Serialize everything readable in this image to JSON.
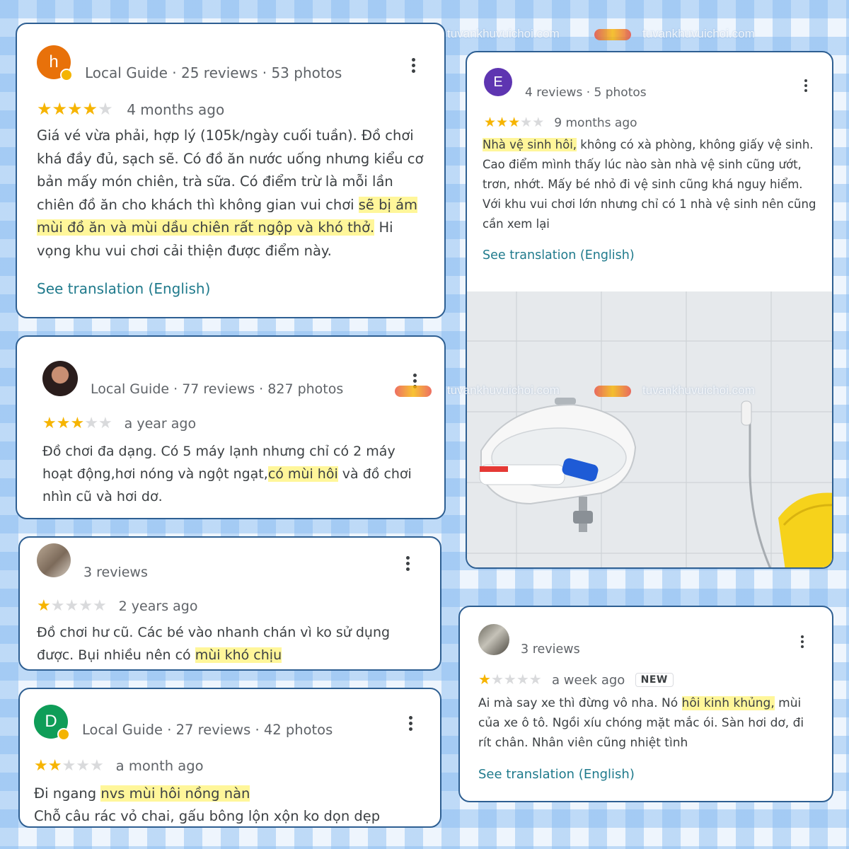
{
  "watermark": {
    "text": "tuvankhuvuichoi.com"
  },
  "reviews": [
    {
      "avatar_letter": "h",
      "avatar_color": "#e8710a",
      "meta": "Local Guide · 25 reviews · 53 photos",
      "rating": 4,
      "time": "4 months ago",
      "text_before": "Giá vé vừa phải, hợp lý (105k/ngày cuối tuần). Đồ chơi khá đầy đủ, sạch sẽ. Có đồ ăn nước uống nhưng kiểu cơ bản mấy món chiên, trà sữa. Có điểm trừ là mỗi lần chiên đồ ăn cho khách thì không gian vui chơi ",
      "highlight": "sẽ bị ám mùi đồ ăn và mùi dầu chiên rất ngộp và khó thở.",
      "text_after": " Hi vọng khu vui chơi cải thiện được điểm này.",
      "link": "See translation (English)"
    },
    {
      "meta": "Local Guide · 77 reviews · 827 photos",
      "rating": 3,
      "time": "a year ago",
      "text_before": "Đồ chơi đa dạng. Có 5  máy lạnh nhưng chỉ có 2 máy hoạt động,hơi nóng và ngột ngạt,",
      "highlight": "có mùi hôi",
      "text_after": " và đồ chơi nhìn cũ và hơi dơ."
    },
    {
      "meta": "3 reviews",
      "rating": 1,
      "time": "2 years ago",
      "text_before": "Đồ chơi hư cũ. Các bé vào nhanh chán vì ko sử dụng được. Bụi nhiều nên có ",
      "highlight": "mùi khó chịu",
      "text_after": ""
    },
    {
      "avatar_letter": "D",
      "avatar_color": "#0f9d58",
      "meta": "Local Guide · 27 reviews · 42 photos",
      "rating": 2,
      "time": "a month ago",
      "text_before": "Đi ngang ",
      "highlight": "nvs mùi hôi nồng nàn",
      "text_after": "",
      "line2": "Chỗ câu rác vỏ chai, gấu bông lộn xộn ko dọn dẹp"
    },
    {
      "avatar_letter": "E",
      "avatar_color": "#5e35b1",
      "meta": "4 reviews · 5 photos",
      "rating": 3,
      "time": "9 months ago",
      "text_before": "",
      "highlight": "Nhà vệ sinh hôi,",
      "text_after": " không có xà phòng, không giấy vệ sinh. Cao điểm mình thấy lúc nào sàn nhà vệ sinh cũng ướt, trơn, nhớt. Mấy bé nhỏ đi vệ sinh cũng khá nguy hiểm. Với khu vui chơi lớn nhưng chỉ có 1 nhà vệ sinh nên cũng cần xem lại",
      "link": "See translation (English)"
    },
    {
      "meta": "3 reviews",
      "rating": 1,
      "time": "a week ago",
      "new_badge": "NEW",
      "text_before": "Ai mà say xe thì đừng vô nha. Nó ",
      "highlight": "hôi kinh khủng,",
      "text_after": " mùi của xe ô tô. Ngồi xíu chóng mặt mắc ói. Sàn hơi dơ, đi rít chân. Nhân viên cũng nhiệt tình",
      "link": "See translation (English)"
    }
  ]
}
